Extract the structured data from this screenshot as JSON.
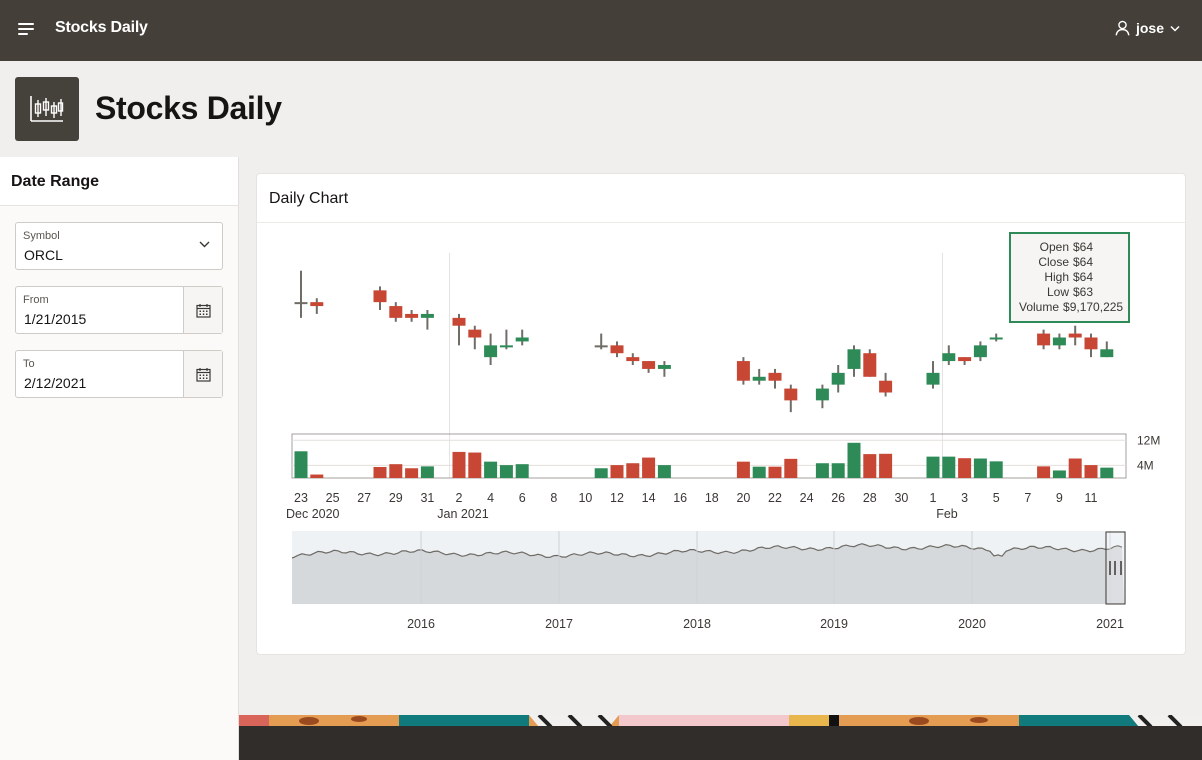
{
  "topbar": {
    "app_title": "Stocks Daily",
    "user": "jose",
    "menu_icon": "hamburger-icon",
    "user_icon": "user-icon"
  },
  "hero": {
    "title": "Stocks Daily",
    "icon": "candlestick-chart-icon"
  },
  "sidebar": {
    "title": "Date Range",
    "symbol": {
      "label": "Symbol",
      "value": "ORCL"
    },
    "from": {
      "label": "From",
      "value": "1/21/2015"
    },
    "to": {
      "label": "To",
      "value": "2/12/2021"
    }
  },
  "card": {
    "title": "Daily Chart"
  },
  "tooltip": {
    "open_label": "Open",
    "open_value": "$64",
    "close_label": "Close",
    "close_value": "$64",
    "high_label": "High",
    "high_value": "$64",
    "low_label": "Low",
    "low_value": "$63",
    "volume_label": "Volume",
    "volume_value": "$9,170,225"
  },
  "colors": {
    "up": "#2e8b57",
    "down": "#c74634",
    "neutral": "#706c66",
    "header_bg": "#444039"
  },
  "chart_data": {
    "type": "candlestick",
    "day_ticks": [
      "23",
      "25",
      "27",
      "29",
      "31",
      "2",
      "4",
      "6",
      "8",
      "10",
      "12",
      "14",
      "16",
      "18",
      "20",
      "22",
      "24",
      "26",
      "28",
      "30",
      "1",
      "3",
      "5",
      "7",
      "9",
      "11"
    ],
    "month_labels": [
      "Dec 2020",
      "Jan 2021",
      "Feb"
    ],
    "volume_ticks": [
      "12M",
      "4M"
    ],
    "volume_axis": {
      "tick_values": [
        12,
        4
      ],
      "unit": "M"
    },
    "overview_years": [
      "2016",
      "2017",
      "2018",
      "2019",
      "2020",
      "2021"
    ],
    "candles": [
      {
        "day": 0,
        "open": 64.4,
        "close": 64.4,
        "high": 65.2,
        "low": 64.0,
        "dir": "neutral",
        "volume": 8.5
      },
      {
        "day": 1,
        "open": 64.3,
        "close": 64.4,
        "high": 64.5,
        "low": 64.1,
        "dir": "down",
        "volume": 1.1
      },
      {
        "day": 5,
        "open": 64.7,
        "close": 64.4,
        "high": 64.8,
        "low": 64.2,
        "dir": "down",
        "volume": 3.5
      },
      {
        "day": 6,
        "open": 64.3,
        "close": 64.0,
        "high": 64.4,
        "low": 63.9,
        "dir": "down",
        "volume": 4.4
      },
      {
        "day": 7,
        "open": 64.1,
        "close": 64.0,
        "high": 64.2,
        "low": 63.9,
        "dir": "down",
        "volume": 3.1
      },
      {
        "day": 8,
        "open": 64.0,
        "close": 64.1,
        "high": 64.2,
        "low": 63.7,
        "dir": "up",
        "volume": 3.7
      },
      {
        "day": 10,
        "open": 64.0,
        "close": 63.8,
        "high": 64.1,
        "low": 63.3,
        "dir": "down",
        "volume": 8.3
      },
      {
        "day": 11,
        "open": 63.7,
        "close": 63.5,
        "high": 63.8,
        "low": 63.2,
        "dir": "down",
        "volume": 8.1
      },
      {
        "day": 12,
        "open": 63.0,
        "close": 63.3,
        "high": 63.6,
        "low": 62.8,
        "dir": "up",
        "volume": 5.2
      },
      {
        "day": 13,
        "open": 63.3,
        "close": 63.3,
        "high": 63.7,
        "low": 63.2,
        "dir": "up",
        "volume": 4.1
      },
      {
        "day": 14,
        "open": 63.4,
        "close": 63.5,
        "high": 63.7,
        "low": 63.3,
        "dir": "up",
        "volume": 4.4
      },
      {
        "day": 19,
        "open": 63.3,
        "close": 63.3,
        "high": 63.6,
        "low": 63.2,
        "dir": "neutral",
        "volume": 3.1
      },
      {
        "day": 20,
        "open": 63.3,
        "close": 63.1,
        "high": 63.4,
        "low": 63.0,
        "dir": "down",
        "volume": 4.1
      },
      {
        "day": 21,
        "open": 63.0,
        "close": 62.9,
        "high": 63.1,
        "low": 62.8,
        "dir": "down",
        "volume": 4.7
      },
      {
        "day": 22,
        "open": 62.9,
        "close": 62.7,
        "high": 62.9,
        "low": 62.6,
        "dir": "down",
        "volume": 6.5
      },
      {
        "day": 23,
        "open": 62.7,
        "close": 62.8,
        "high": 62.9,
        "low": 62.5,
        "dir": "up",
        "volume": 4.1
      },
      {
        "day": 28,
        "open": 62.9,
        "close": 62.4,
        "high": 63.0,
        "low": 62.3,
        "dir": "down",
        "volume": 5.2
      },
      {
        "day": 29,
        "open": 62.4,
        "close": 62.5,
        "high": 62.7,
        "low": 62.3,
        "dir": "up",
        "volume": 3.6
      },
      {
        "day": 30,
        "open": 62.6,
        "close": 62.4,
        "high": 62.7,
        "low": 62.2,
        "dir": "down",
        "volume": 3.6
      },
      {
        "day": 31,
        "open": 62.2,
        "close": 61.9,
        "high": 62.3,
        "low": 61.6,
        "dir": "down",
        "volume": 6.1
      },
      {
        "day": 33,
        "open": 61.9,
        "close": 62.2,
        "high": 62.3,
        "low": 61.7,
        "dir": "up",
        "volume": 4.7
      },
      {
        "day": 34,
        "open": 62.3,
        "close": 62.6,
        "high": 62.8,
        "low": 62.1,
        "dir": "up",
        "volume": 4.7
      },
      {
        "day": 35,
        "open": 62.7,
        "close": 63.2,
        "high": 63.3,
        "low": 62.5,
        "dir": "up",
        "volume": 11.2
      },
      {
        "day": 36,
        "open": 63.1,
        "close": 62.5,
        "high": 63.2,
        "low": 62.5,
        "dir": "down",
        "volume": 7.6
      },
      {
        "day": 37,
        "open": 62.4,
        "close": 62.1,
        "high": 62.6,
        "low": 62.0,
        "dir": "down",
        "volume": 7.7
      },
      {
        "day": 40,
        "open": 62.3,
        "close": 62.6,
        "high": 62.9,
        "low": 62.2,
        "dir": "up",
        "volume": 6.8
      },
      {
        "day": 41,
        "open": 62.9,
        "close": 63.1,
        "high": 63.3,
        "low": 62.8,
        "dir": "up",
        "volume": 6.8
      },
      {
        "day": 42,
        "open": 63.0,
        "close": 62.9,
        "high": 63.0,
        "low": 62.8,
        "dir": "down",
        "volume": 6.3
      },
      {
        "day": 43,
        "open": 63.0,
        "close": 63.3,
        "high": 63.4,
        "low": 62.9,
        "dir": "up",
        "volume": 6.2
      },
      {
        "day": 44,
        "open": 63.5,
        "close": 63.5,
        "high": 63.6,
        "low": 63.4,
        "dir": "up",
        "volume": 5.3
      },
      {
        "day": 47,
        "open": 63.6,
        "close": 63.3,
        "high": 63.7,
        "low": 63.2,
        "dir": "down",
        "volume": 3.7
      },
      {
        "day": 48,
        "open": 63.3,
        "close": 63.5,
        "high": 63.6,
        "low": 63.2,
        "dir": "up",
        "volume": 2.4
      },
      {
        "day": 49,
        "open": 63.5,
        "close": 63.6,
        "high": 63.8,
        "low": 63.3,
        "dir": "down",
        "volume": 6.2
      },
      {
        "day": 50,
        "open": 63.5,
        "close": 63.2,
        "high": 63.6,
        "low": 63.0,
        "dir": "down",
        "volume": 4.1
      },
      {
        "day": 51,
        "open": 63.0,
        "close": 63.2,
        "high": 63.4,
        "low": 63.0,
        "dir": "up",
        "volume": 3.3
      }
    ],
    "price_range": [
      61.4,
      65.6
    ],
    "volume_range": [
      0,
      14
    ]
  }
}
